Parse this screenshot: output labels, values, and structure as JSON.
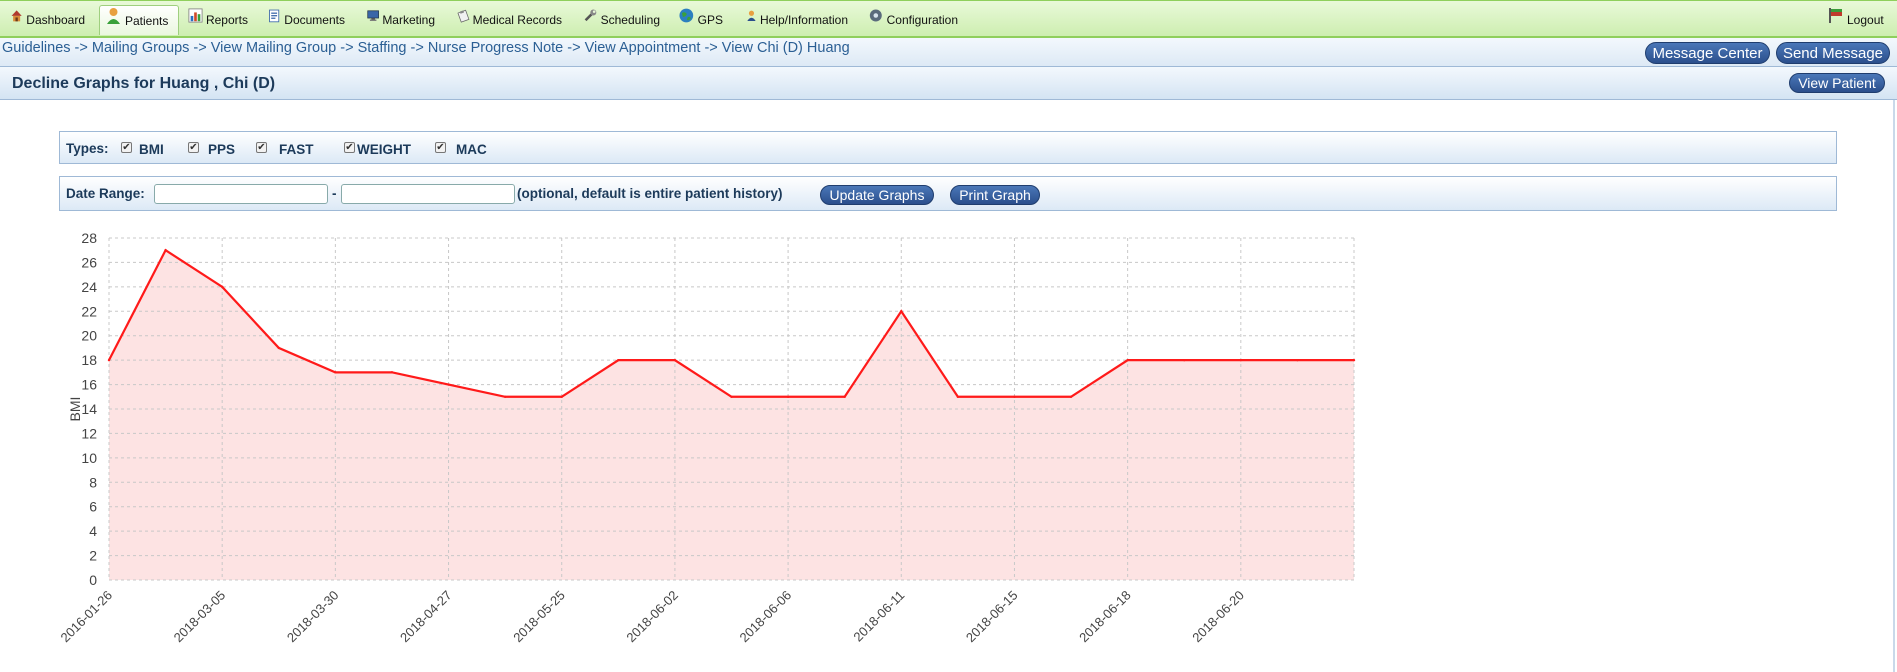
{
  "nav": {
    "items": [
      {
        "id": "dashboard",
        "label": "Dashboard",
        "icon": "house-icon",
        "x": 5,
        "w": 85
      },
      {
        "id": "patients",
        "label": "Patients",
        "icon": "person-icon",
        "x": 99,
        "w": 80,
        "active": true
      },
      {
        "id": "reports",
        "label": "Reports",
        "icon": "bar-chart-icon",
        "x": 183,
        "w": 70
      },
      {
        "id": "documents",
        "label": "Documents",
        "icon": "document-icon",
        "x": 262,
        "w": 88
      },
      {
        "id": "marketing",
        "label": "Marketing",
        "icon": "monitor-icon",
        "x": 362,
        "w": 78
      },
      {
        "id": "medical-records",
        "label": "Medical Records",
        "icon": "clipboard-icon",
        "x": 452,
        "w": 115
      },
      {
        "id": "scheduling",
        "label": "Scheduling",
        "icon": "wrench-icon",
        "x": 578,
        "w": 87
      },
      {
        "id": "gps",
        "label": "GPS",
        "icon": "globe-icon",
        "x": 673,
        "w": 55
      },
      {
        "id": "help",
        "label": "Help/Information",
        "icon": "person-help-icon",
        "x": 741,
        "w": 112
      },
      {
        "id": "configuration",
        "label": "Configuration",
        "icon": "gear-icon",
        "x": 863,
        "w": 100
      }
    ],
    "logout_label": "Logout"
  },
  "breadcrumb": [
    "Guidelines",
    "Mailing Groups",
    "View Mailing Group",
    "Staffing",
    "Nurse Progress Note",
    "View Appointment",
    "View Chi (D) Huang"
  ],
  "breadcrumb_sep": " -> ",
  "header": {
    "message_center_label": "Message Center",
    "send_message_label": "Send Message",
    "title": "Decline Graphs for Huang , Chi (D)",
    "view_patient_label": "View Patient"
  },
  "filters": {
    "types_label": "Types:",
    "types": [
      {
        "label": "BMI",
        "checked": true
      },
      {
        "label": "PPS",
        "checked": true
      },
      {
        "label": "FAST",
        "checked": true
      },
      {
        "label": "WEIGHT",
        "checked": true
      },
      {
        "label": "MAC",
        "checked": true
      }
    ],
    "date_range_label": "Date Range:",
    "start_date": "",
    "end_date": "",
    "range_separator": "-",
    "optional_note": "(optional, default is entire patient history)",
    "update_label": "Update Graphs",
    "print_label": "Print Graph"
  },
  "chart_data": {
    "type": "area",
    "ylabel": "BMI",
    "xlabel": "",
    "ylim": [
      0,
      28
    ],
    "yticks": [
      0,
      2,
      4,
      6,
      8,
      10,
      12,
      14,
      16,
      18,
      20,
      22,
      24,
      26,
      28
    ],
    "grid": true,
    "x_tick_labels": [
      "2016-01-26",
      "2018-03-05",
      "2018-03-30",
      "2018-04-27",
      "2018-05-25",
      "2018-06-02",
      "2018-06-06",
      "2018-06-11",
      "2018-06-15",
      "2018-06-18",
      "2018-06-20"
    ],
    "series": [
      {
        "color": "#ff1a1a",
        "fill": "#fde3e3",
        "values": [
          18,
          27,
          24,
          19,
          17,
          17,
          16,
          15,
          15,
          18,
          18,
          15,
          15,
          15,
          22,
          15,
          15,
          15,
          18,
          18,
          18,
          18,
          18
        ]
      }
    ]
  }
}
